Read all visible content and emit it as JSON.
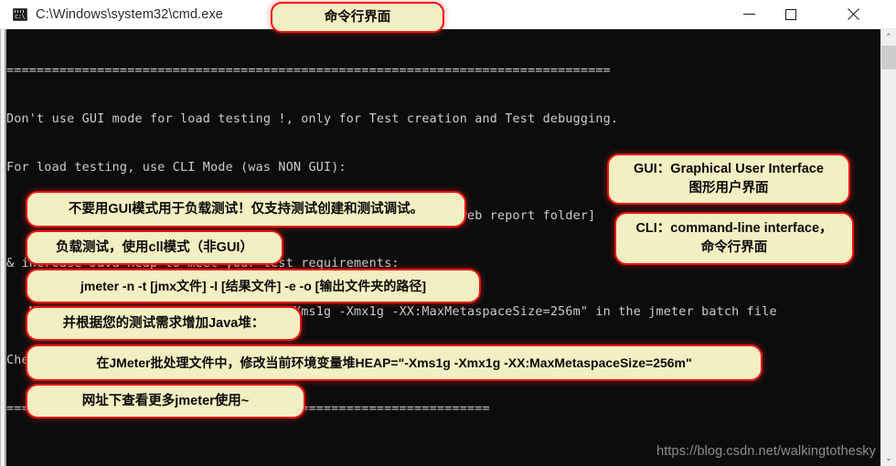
{
  "window": {
    "title": "C:\\Windows\\system32\\cmd.exe",
    "app_icon": "cmd-console-icon",
    "minimize_label": "—",
    "maximize_label": "□",
    "close_label": "✕"
  },
  "console": {
    "background_color": "#0c0c0c",
    "text_color": "#cccccc",
    "lines": [
      "================================================================================",
      "Don't use GUI mode for load testing !, only for Test creation and Test debugging.",
      "For load testing, use CLI Mode (was NON GUI):",
      "   jmeter -n -t [jmx file] -l [results file] -e -o [Path to web report folder]",
      "& increase Java Heap to meet your test requirements:",
      "   Modify current env variable HEAP=\"-Xms1g -Xmx1g -XX:MaxMetaspaceSize=256m\" in the jmeter batch file",
      "Check : https://jmeter.apache.org/usermanual/best-practices.html",
      "================================================================"
    ]
  },
  "annotations": {
    "border_color": "#ee1111",
    "fill_color": "#f2efc2",
    "titlebar_note": "命令行界面",
    "left_notes": [
      "不要用GUI模式用于负载测试！仅支持测试创建和测试调试。",
      "负载测试，使用cll模式（非GUI）",
      "jmeter -n -t [jmx文件] -l [结果文件] -e -o [输出文件夹的路径]",
      "并根据您的测试需求增加Java堆：",
      "在JMeter批处理文件中，修改当前环境变量堆HEAP=\"-Xms1g -Xmx1g -XX:MaxMetaspaceSize=256m\"",
      "网址下查看更多jmeter使用~"
    ],
    "right_notes": [
      {
        "line1": "GUI：Graphical User Interface",
        "line2": "图形用户界面"
      },
      {
        "line1": "CLI：command-line interface，",
        "line2": "命令行界面"
      }
    ]
  },
  "watermark": {
    "text": "https://blog.csdn.net/walkingtothesky"
  },
  "scrollbar": {
    "up_arrow": "⌃",
    "down_arrow": "⌄"
  }
}
